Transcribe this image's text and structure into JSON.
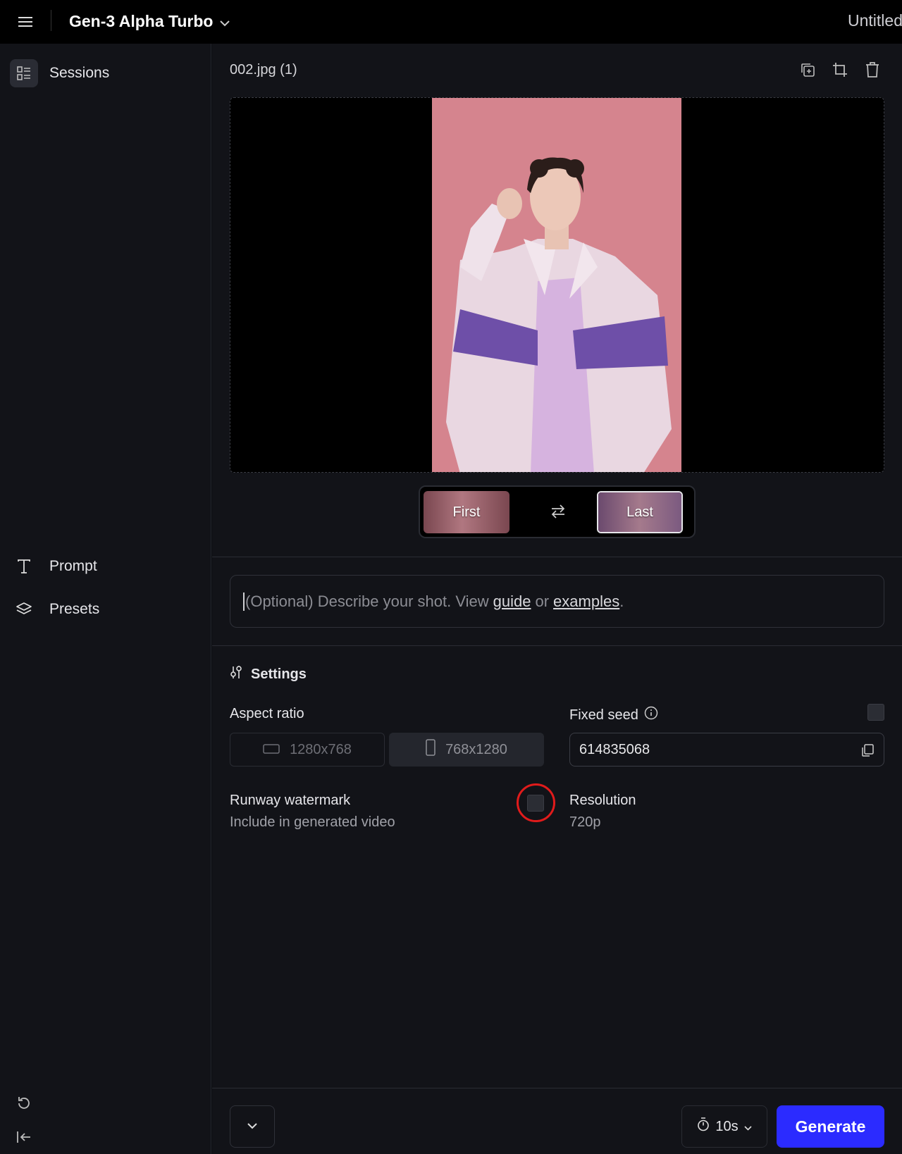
{
  "topbar": {
    "menu_icon": "hamburger-menu-icon",
    "model_name": "Gen-3 Alpha Turbo",
    "doc_title": "Untitled"
  },
  "sidebar": {
    "items": [
      {
        "label": "Sessions",
        "icon": "sessions-list-icon"
      },
      {
        "label": "Prompt",
        "icon": "text-t-icon"
      },
      {
        "label": "Presets",
        "icon": "layers-icon"
      }
    ],
    "bottom_icons": [
      "undo-history-icon",
      "collapse-sidebar-icon"
    ]
  },
  "asset": {
    "file_name": "002.jpg (1)",
    "tools": [
      "duplicate-icon",
      "crop-icon",
      "trash-icon"
    ]
  },
  "frames": {
    "first_label": "First",
    "last_label": "Last",
    "swap_icon": "swap-arrows-icon"
  },
  "prompt": {
    "placeholder_before": "(Optional) Describe your shot. View",
    "guide_link": "guide",
    "or_text": "or",
    "examples_link": "examples",
    "end_punct": "."
  },
  "settings": {
    "header": "Settings",
    "aspect_ratio_label": "Aspect ratio",
    "ratio_options": [
      "1280x768",
      "768x1280"
    ],
    "selected_ratio": "768x1280",
    "fixed_seed_label": "Fixed seed",
    "fixed_seed_checked": false,
    "seed_value": "614835068",
    "watermark_label": "Runway watermark",
    "watermark_sub": "Include in generated video",
    "watermark_checked": false,
    "resolution_label": "Resolution",
    "resolution_value": "720p"
  },
  "bottom": {
    "duration": "10s",
    "generate_label": "Generate"
  },
  "colors": {
    "accent": "#2b2bff",
    "highlight_ring": "#e01b1b",
    "photo_background": "#d5848e"
  }
}
